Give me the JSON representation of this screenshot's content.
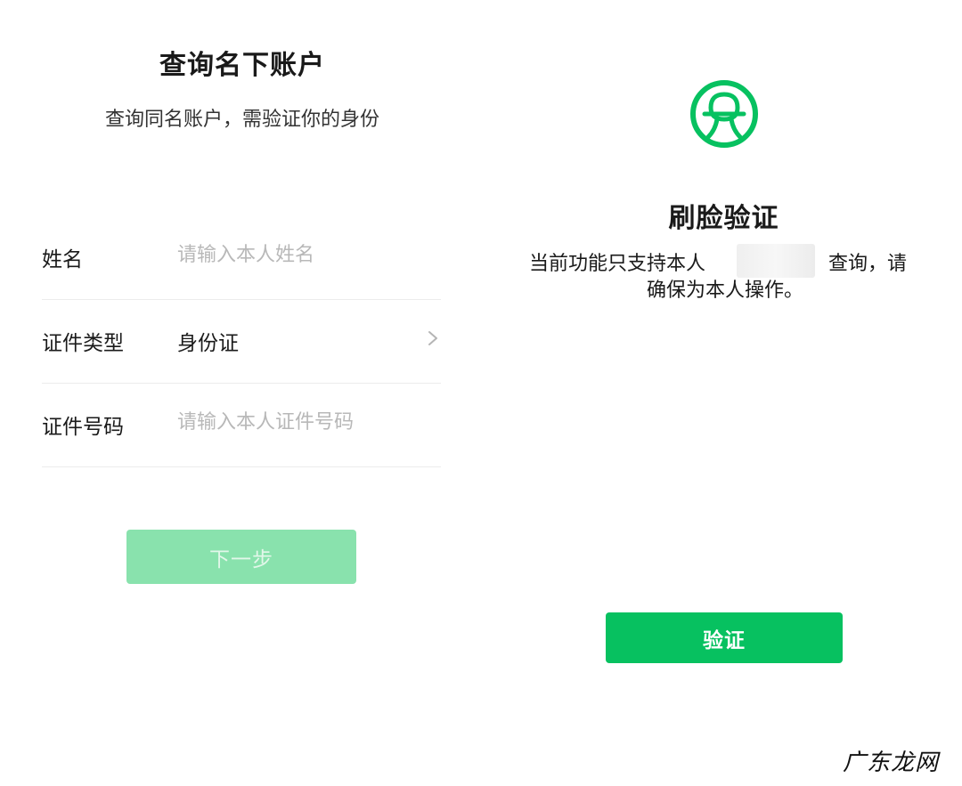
{
  "left": {
    "title": "查询名下账户",
    "subtitle": "查询同名账户，需验证你的身份",
    "form": {
      "name_label": "姓名",
      "name_placeholder": "请输入本人姓名",
      "id_type_label": "证件类型",
      "id_type_value": "身份证",
      "id_number_label": "证件号码",
      "id_number_placeholder": "请输入本人证件号码"
    },
    "next_button_label": "下一步"
  },
  "right": {
    "logo_icon": "face-verification-logo-icon",
    "title": "刷脸验证",
    "notice_part1": "当前功能只支持本人",
    "notice_part2": "查询，请",
    "notice_line2": "确保为本人操作。",
    "verify_button_label": "验证"
  },
  "watermark": "广东龙网",
  "colors": {
    "brand_green": "#07c160",
    "disabled_green": "#89e2ad",
    "placeholder_gray": "#b8b8b8"
  }
}
